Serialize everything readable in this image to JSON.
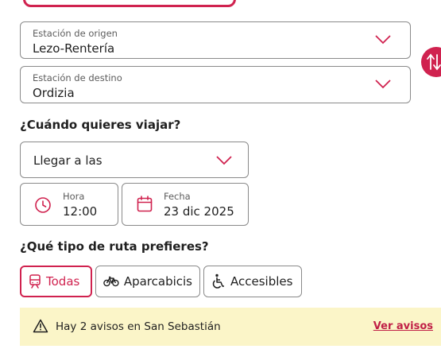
{
  "origin": {
    "label": "Estación de origen",
    "value": "Lezo-Rentería"
  },
  "destination": {
    "label": "Estación de destino",
    "value": "Ordizia"
  },
  "when": {
    "title": "¿Cuándo quieres viajar?",
    "mode_value": "Llegar a las",
    "time_label": "Hora",
    "time_value": "12:00",
    "date_label": "Fecha",
    "date_value": "23 dic 2025"
  },
  "route": {
    "title": "¿Qué tipo de ruta prefieres?",
    "options": [
      {
        "label": "Todas",
        "icon": "train-icon",
        "selected": true
      },
      {
        "label": "Aparcabicis",
        "icon": "bicycle-icon",
        "selected": false
      },
      {
        "label": "Accesibles",
        "icon": "wheelchair-icon",
        "selected": false
      }
    ]
  },
  "notice": {
    "text": "Hay 2 avisos en San Sebastián",
    "link": "Ver avisos"
  },
  "colors": {
    "accent": "#d0224f",
    "banner_bg": "#fbf5c8",
    "border": "#8a8a8a"
  }
}
